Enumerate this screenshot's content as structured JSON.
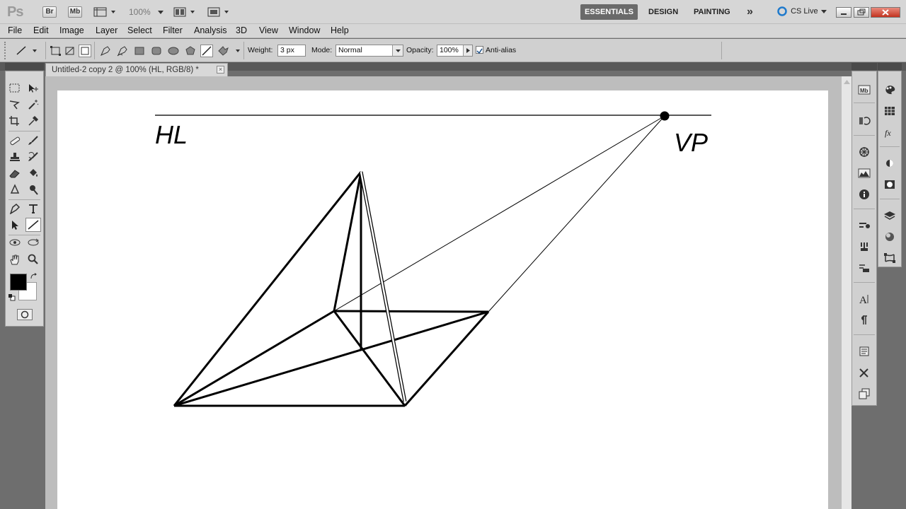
{
  "app": {
    "logo": "Ps",
    "bridge_label": "Br",
    "minibridge_label": "Mb",
    "zoom": "100%",
    "workspaces": [
      "ESSENTIALS",
      "DESIGN",
      "PAINTING"
    ],
    "active_workspace": "ESSENTIALS",
    "cs_live": "CS Live",
    "overflow": "»"
  },
  "menu": [
    "File",
    "Edit",
    "Image",
    "Layer",
    "Select",
    "Filter",
    "Analysis",
    "3D",
    "View",
    "Window",
    "Help"
  ],
  "options": {
    "weight_label": "Weight:",
    "weight_value": "3 px",
    "mode_label": "Mode:",
    "mode_value": "Normal",
    "opacity_label": "Opacity:",
    "opacity_value": "100%",
    "antialias_label": "Anti-alias",
    "antialias_checked": true
  },
  "document": {
    "tab_title": "Untitled-2 copy 2 @ 100% (HL, RGB/8) *",
    "close_glyph": "×"
  },
  "canvas_text": {
    "hl": "HL",
    "vp": "VP"
  },
  "colors": {
    "foreground": "#000000",
    "background": "#ffffff",
    "accent_workspace": "#6a6a6a"
  }
}
